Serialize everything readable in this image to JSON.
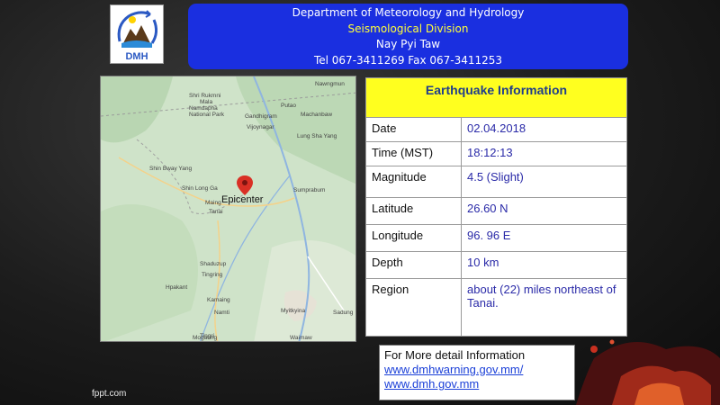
{
  "header": {
    "department": "Department of Meteorology and Hydrology",
    "division": "Seismological Division",
    "city": "Nay Pyi Taw",
    "contact": "Tel 067-3411269 Fax 067-3411253"
  },
  "logo": {
    "text": "DMH"
  },
  "map": {
    "epicenter_label": "Epicenter",
    "places": [
      "Shri Rukmni",
      "Mala",
      "Namdapha",
      "National Park",
      "Nawngmun",
      "Putao",
      "Machanbaw",
      "Gandhigram",
      "Vijoynagar",
      "Lung Sha Yang",
      "Shin Bway Yang",
      "Shin Long Ga",
      "Sumprabum",
      "Maing",
      "Tanai",
      "Shaduzup",
      "Tingring",
      "Hpakant",
      "Kamaing",
      "Myitkyina",
      "Namti",
      "Sadung",
      "Mogaung",
      "Waimaw",
      "Tingri"
    ]
  },
  "info": {
    "title": "Earthquake Information",
    "rows": [
      {
        "label": "Date",
        "value": "02.04.2018"
      },
      {
        "label": "Time (MST)",
        "value": "18:12:13"
      },
      {
        "label": "Magnitude",
        "value": "4.5 (Slight)"
      },
      {
        "label": "Latitude",
        "value": "26.60 N"
      },
      {
        "label": "Longitude",
        "value": "96. 96 E"
      },
      {
        "label": "Depth",
        "value": "10 km"
      },
      {
        "label": "Region",
        "value": "about (22) miles northeast of Tanai."
      }
    ]
  },
  "detail": {
    "title": "For More detail Information",
    "link1": "www.dmhwarning.gov.mm/",
    "link2": "www.dmh.gov.mm"
  },
  "footer": {
    "credit": "fppt.com"
  },
  "colors": {
    "header_bg": "#1a2fe0",
    "header_accent": "#ffff3a",
    "table_title_bg": "#ffff1f",
    "table_title_fg": "#1f3d8c",
    "value_fg": "#2a2aa8",
    "link_fg": "#1a3fd8",
    "map_green": "#cfe3c9",
    "pin_red": "#d93025"
  }
}
